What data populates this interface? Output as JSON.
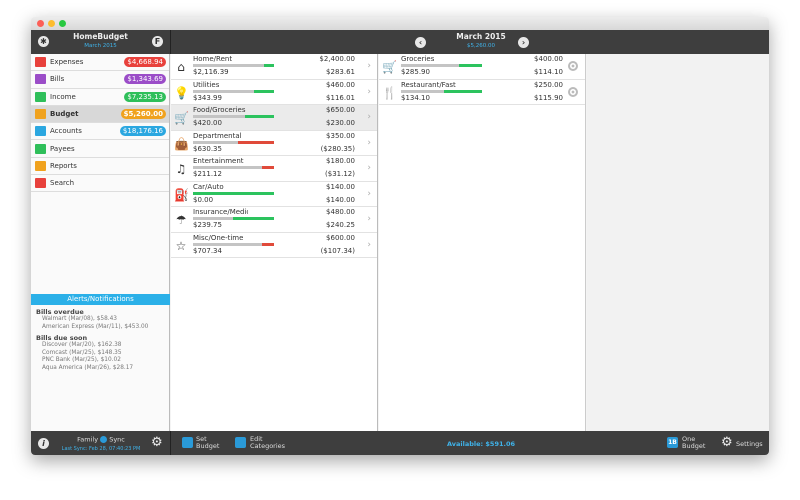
{
  "app": {
    "title": "HomeBudget",
    "period": "March 2015"
  },
  "header": {
    "left_icon": "wrench-icon",
    "right_icon": "f-icon",
    "month": "March 2015",
    "total": "$5,260.00"
  },
  "sidebar": {
    "items": [
      {
        "label": "Expenses",
        "badge": "$4,668.94",
        "color": "#e8413c",
        "icon": "wallet-icon"
      },
      {
        "label": "Bills",
        "badge": "$1,343.69",
        "color": "#9b4dc8",
        "icon": "calendar-icon"
      },
      {
        "label": "Income",
        "badge": "$7,235.13",
        "color": "#2fbf5a",
        "icon": "money-bag-icon"
      },
      {
        "label": "Budget",
        "badge": "$5,260.00",
        "color": "#f0a21e",
        "icon": "folder-icon",
        "selected": true
      },
      {
        "label": "Accounts",
        "badge": "$18,176.16",
        "color": "#2ba7e0",
        "icon": "accounts-icon"
      },
      {
        "label": "Payees",
        "badge": null,
        "color": "#2fbf5a",
        "icon": "people-icon"
      },
      {
        "label": "Reports",
        "badge": null,
        "color": "#f0a21e",
        "icon": "chart-icon"
      },
      {
        "label": "Search",
        "badge": null,
        "color": "#e8413c",
        "icon": "search-icon"
      }
    ]
  },
  "alerts": {
    "title": "Alerts/Notifications",
    "sections": [
      {
        "title": "Bills overdue",
        "items": [
          "Walmart (Mar/08), $58.43",
          "American Express (Mar/11), $453.00"
        ]
      },
      {
        "title": "Bills due soon",
        "items": [
          "Discover (Mar/20), $162.38",
          "Comcast (Mar/25), $148.35",
          "PNC Bank (Mar/25), $10.02",
          "Aqua America (Mar/26), $28.17"
        ]
      }
    ]
  },
  "categories": [
    {
      "name": "Home/Rent",
      "budget": "$2,400.00",
      "spent": "$2,116.39",
      "remaining": "$283.61",
      "b": 2400,
      "s": 2116.39,
      "icon": "house-icon",
      "glyph": "⌂"
    },
    {
      "name": "Utilities",
      "budget": "$460.00",
      "spent": "$343.99",
      "remaining": "$116.01",
      "b": 460,
      "s": 343.99,
      "icon": "lightbulb-icon",
      "glyph": "💡"
    },
    {
      "name": "Food/Groceries",
      "budget": "$650.00",
      "spent": "$420.00",
      "remaining": "$230.00",
      "b": 650,
      "s": 420,
      "icon": "cart-icon",
      "glyph": "🛒",
      "selected": true
    },
    {
      "name": "Departmental",
      "budget": "$350.00",
      "spent": "$630.35",
      "remaining": "($280.35)",
      "b": 350,
      "s": 630.35,
      "icon": "shopping-bag-icon",
      "glyph": "👜"
    },
    {
      "name": "Entertainment",
      "budget": "$180.00",
      "spent": "$211.12",
      "remaining": "($31.12)",
      "b": 180,
      "s": 211.12,
      "icon": "music-note-icon",
      "glyph": "♫"
    },
    {
      "name": "Car/Auto",
      "budget": "$140.00",
      "spent": "$0.00",
      "remaining": "$140.00",
      "b": 140,
      "s": 0,
      "icon": "gas-pump-icon",
      "glyph": "⛽"
    },
    {
      "name": "Insurance/Medical",
      "budget": "$480.00",
      "spent": "$239.75",
      "remaining": "$240.25",
      "b": 480,
      "s": 239.75,
      "icon": "umbrella-icon",
      "glyph": "☂"
    },
    {
      "name": "Misc/One-time",
      "budget": "$600.00",
      "spent": "$707.34",
      "remaining": "($107.34)",
      "b": 600,
      "s": 707.34,
      "icon": "star-icon",
      "glyph": "☆"
    }
  ],
  "subcategories": [
    {
      "name": "Groceries",
      "budget": "$400.00",
      "spent": "$285.90",
      "remaining": "$114.10",
      "b": 400,
      "s": 285.9,
      "icon": "cart-icon",
      "glyph": "🛒"
    },
    {
      "name": "Restaurant/Fast food",
      "budget": "$250.00",
      "spent": "$134.10",
      "remaining": "$115.90",
      "b": 250,
      "s": 134.1,
      "icon": "fork-knife-icon",
      "glyph": "🍴"
    }
  ],
  "bottom": {
    "family": "Family",
    "sync": "Sync",
    "last_sync": "Last Sync: Feb 28, 07:40:23 PM",
    "set": "Set",
    "budget": "Budget",
    "edit": "Edit",
    "categories": "Categories",
    "available": "Available: $591.06",
    "one": "One",
    "one_budget": "Budget",
    "one_badge": "1B",
    "settings": "Settings"
  },
  "colors": {
    "green": "#2cc35e",
    "red": "#e04a3a",
    "gray": "#c4c4c4",
    "accent": "#2bb0e8"
  }
}
